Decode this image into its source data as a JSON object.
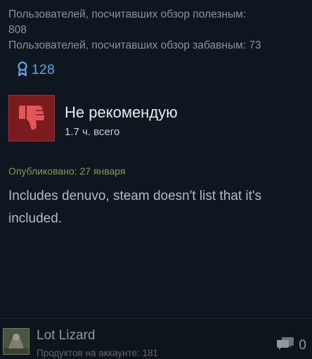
{
  "votes": {
    "helpful_line_1": "Пользователей, посчитавших обзор полезным:",
    "helpful_line_2": "808",
    "funny_line": "Пользователей, посчитавших обзор забавным: 73"
  },
  "awards": {
    "icon": "award-ribbon-icon",
    "count": "128",
    "color": "#5aa9e6"
  },
  "verdict": {
    "icon": "thumbs-down-icon",
    "title": "Не рекомендую",
    "hours": "1.7 ч. всего",
    "badge_color": "#7a1c1f",
    "icon_color": "#e2585a"
  },
  "review": {
    "posted": "Опубликовано: 27 января",
    "text": "Includes denuvo, steam doesn't list that it's included."
  },
  "author": {
    "name": "Lot Lizard",
    "products": "Продуктов на аккаунте: 181",
    "avatar": "avatar-image"
  },
  "comments": {
    "icon": "comment-bubbles-icon",
    "count": "0"
  }
}
